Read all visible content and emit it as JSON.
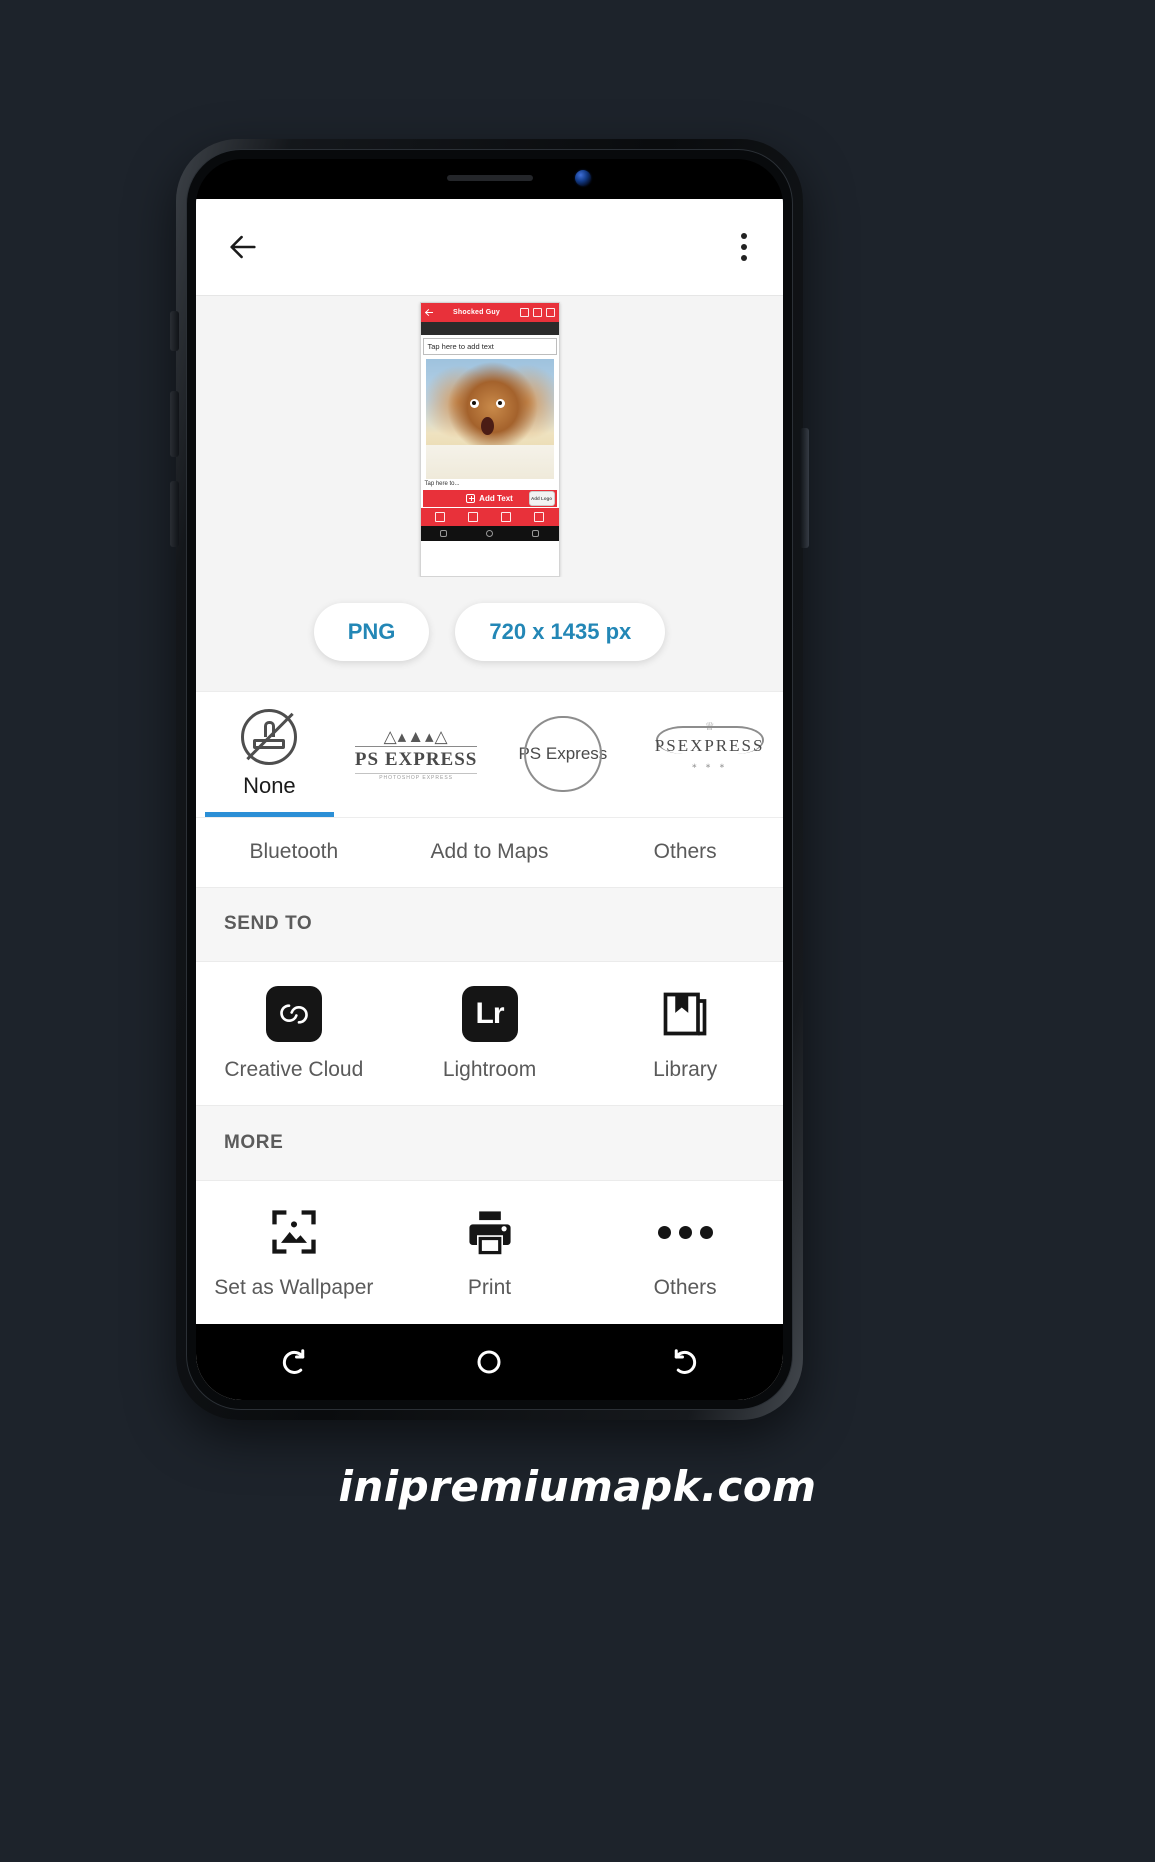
{
  "appbar": {
    "back_icon": "back-arrow-icon",
    "menu_icon": "overflow-menu-icon"
  },
  "preview": {
    "thumb_title": "Shocked Guy",
    "thumb_text_placeholder": "Tap here to add text",
    "thumb_caption": "Tap here to...",
    "thumb_add_text_label": "Add Text",
    "thumb_chip_label": "Add Logo"
  },
  "export": {
    "format_label": "PNG",
    "dimensions_label": "720 x 1435 px"
  },
  "watermarks": {
    "items": [
      {
        "label": "None",
        "icon": "no-stamp-icon",
        "selected": true
      },
      {
        "label": "PS EXPRESS",
        "sub": "PHOTOSHOP EXPRESS",
        "icon": "mountain-logo-icon",
        "selected": false
      },
      {
        "label": "PS Express",
        "icon": "arc-logo-icon",
        "selected": false
      },
      {
        "label": "PSEXPRESS",
        "icon": "crown-logo-icon",
        "selected": false
      }
    ],
    "accent_color": "#2b8fd6"
  },
  "share_targets": [
    {
      "label": "Bluetooth"
    },
    {
      "label": "Add to Maps"
    },
    {
      "label": "Others"
    }
  ],
  "send_to": {
    "header": "SEND TO",
    "items": [
      {
        "label": "Creative Cloud",
        "icon": "creative-cloud-icon"
      },
      {
        "label": "Lightroom",
        "icon": "lightroom-icon"
      },
      {
        "label": "Library",
        "icon": "library-icon"
      }
    ]
  },
  "more": {
    "header": "MORE",
    "items": [
      {
        "label": "Set as Wallpaper",
        "icon": "wallpaper-icon"
      },
      {
        "label": "Print",
        "icon": "printer-icon"
      },
      {
        "label": "Others",
        "icon": "ellipsis-icon"
      }
    ]
  },
  "android_nav": {
    "recents_icon": "recents-icon",
    "home_icon": "home-icon",
    "back_icon": "nav-back-icon"
  },
  "site_watermark": "inipremiumapk.com"
}
